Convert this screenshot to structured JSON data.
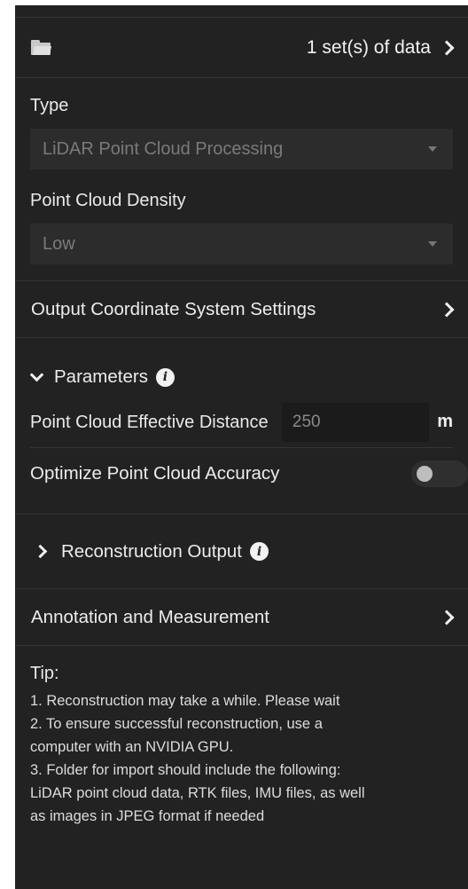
{
  "header": {
    "dataset_label": "1 set(s) of data"
  },
  "type": {
    "label": "Type",
    "value": "LiDAR Point Cloud Processing"
  },
  "density": {
    "label": "Point Cloud Density",
    "value": "Low"
  },
  "coord": {
    "label": "Output Coordinate System Settings"
  },
  "parameters": {
    "title": "Parameters",
    "info": "i",
    "distance_label": "Point Cloud Effective Distance",
    "distance_value": "250",
    "distance_unit": "m",
    "optimize_label": "Optimize Point Cloud Accuracy",
    "optimize_on": false
  },
  "reconstruction": {
    "title": "Reconstruction Output",
    "info": "i"
  },
  "annotation": {
    "label": "Annotation and Measurement"
  },
  "tip": {
    "title": "Tip:",
    "lines": [
      "1. Reconstruction may take a while. Please wait",
      "2. To ensure successful reconstruction, use a",
      "computer with an NVIDIA GPU.",
      "3. Folder for import should include the following:",
      "LiDAR point cloud data, RTK files, IMU files, as well",
      "as images in JPEG format if needed"
    ]
  },
  "icons": {
    "folder": "folder-icon",
    "chevron_right": "chevron-right-icon",
    "chevron_down": "chevron-down-icon",
    "info": "info-icon",
    "caret": "caret-down-icon"
  },
  "colors": {
    "panel_bg": "#222222",
    "field_bg": "#2c2c2c",
    "text": "#e8e8e8",
    "muted": "#7a7a7a"
  }
}
